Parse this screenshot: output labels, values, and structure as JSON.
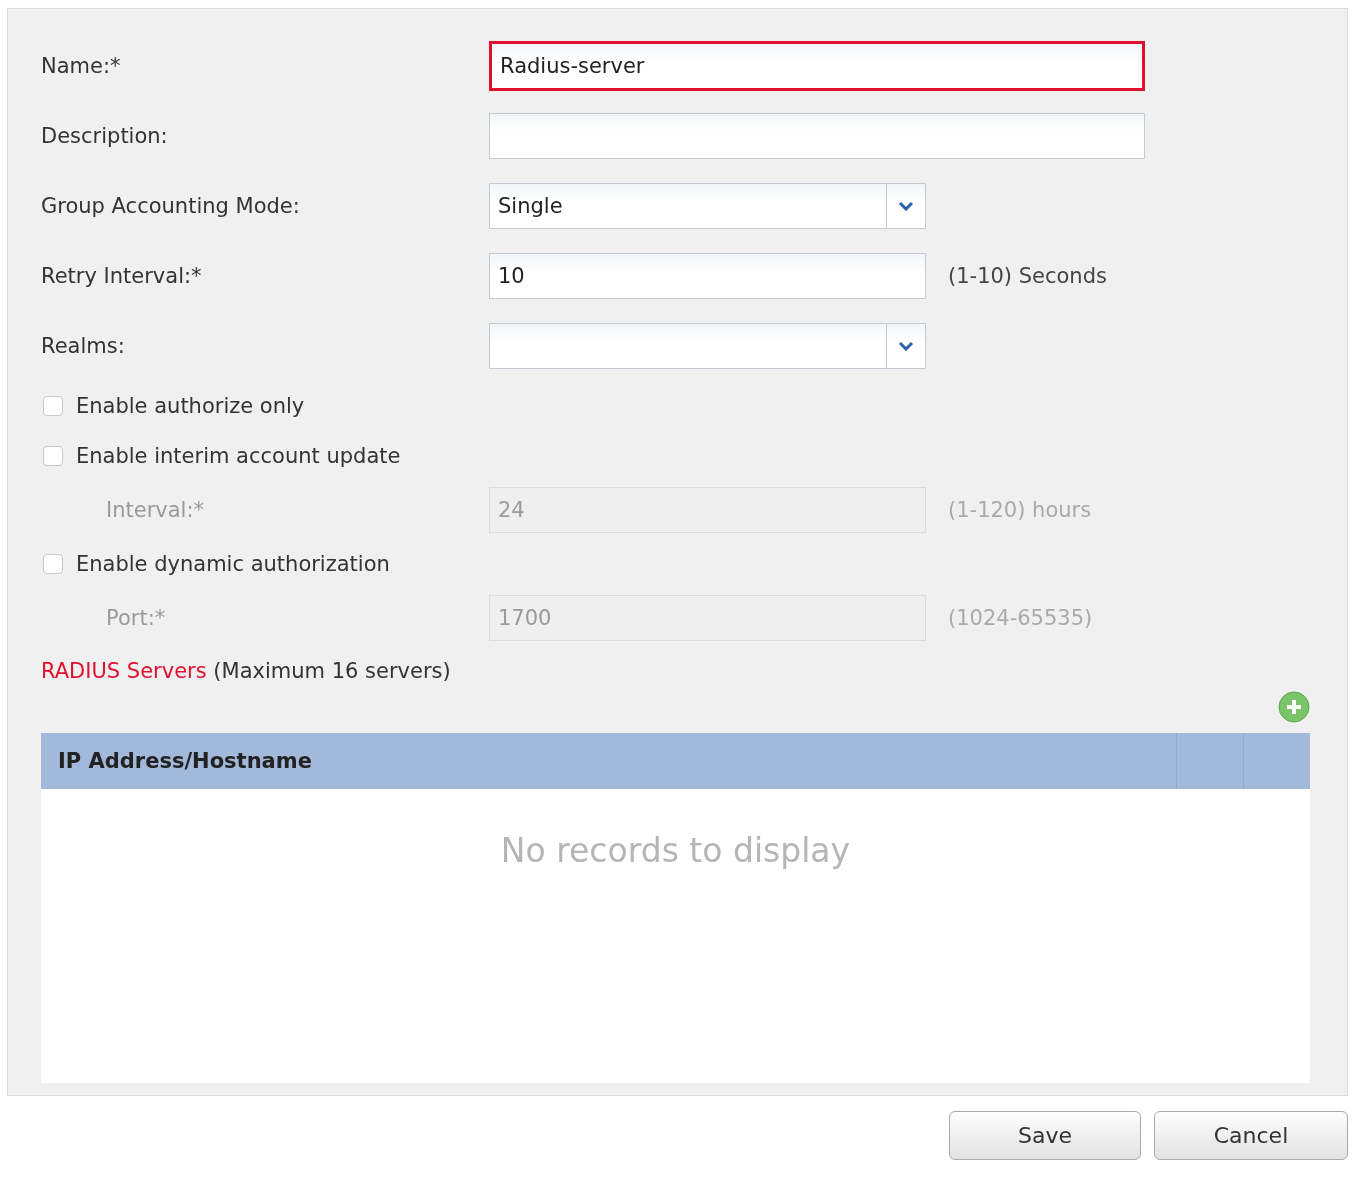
{
  "form": {
    "fields": [
      {
        "kind": "text",
        "label": "Name:*",
        "value": "Radius-server",
        "invalid": true
      },
      {
        "kind": "text",
        "label": "Description:",
        "invalid": false
      },
      {
        "kind": "select",
        "label": "Group Accounting Mode:",
        "value": "Single"
      },
      {
        "kind": "text",
        "label": "Retry Interval:*",
        "value": "10",
        "hint": "(1-10) Seconds",
        "invalid": false
      },
      {
        "kind": "select",
        "label": "Realms:"
      },
      {
        "kind": "checkbox",
        "label": "Enable authorize only",
        "checked": false
      },
      {
        "kind": "checkbox",
        "label": "Enable interim account update",
        "checked": false,
        "children": [
          {
            "kind": "text",
            "label": "Interval:*",
            "value": "24",
            "hint": "(1-120) hours",
            "invalid": false,
            "disabled": true
          }
        ]
      },
      {
        "kind": "checkbox",
        "label": "Enable dynamic authorization",
        "checked": false,
        "children": [
          {
            "kind": "text",
            "label": "Port:*",
            "value": "1700",
            "hint": "(1024-65535)",
            "invalid": false,
            "disabled": true
          }
        ]
      }
    ]
  },
  "servers": {
    "title": "RADIUS Servers",
    "note": "(Maximum 16 servers)",
    "columns": [
      "IP Address/Hostname"
    ],
    "empty_text": "No records to display"
  },
  "buttons": [
    "Save",
    "Cancel"
  ]
}
